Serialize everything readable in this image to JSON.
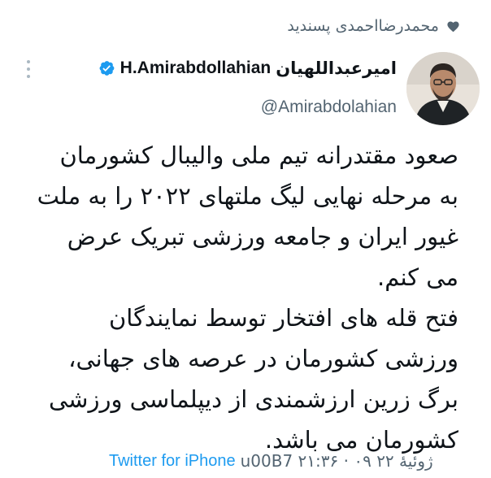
{
  "social_context": {
    "text": "محمدرضااحمدی پسندید"
  },
  "author": {
    "display_name_fa": "امیرعبداللهیان",
    "display_name_en": "H.Amirabdollahian",
    "handle": "@Amirabdolahian",
    "verified": true
  },
  "tweet": {
    "text": "صعود مقتدرانه تیم ملی والیبال کشورمان\nبه مرحله نهایی لیگ ملتهای ۲۰۲۲ را به ملت\nغیور ایران و جامعه ورزشی تبریک عرض\nمی کنم.\nفتح قله های افتخار توسط نمایندگان\nورزشی کشورمان در عرصه های جهانی،\nبرگ زرین ارزشمندی از دیپلماسی ورزشی\nکشورمان می باشد."
  },
  "footer": {
    "source": "Twitter for iPhone",
    "timestamp": "u00B7 ۲۱:۳۶ · ۰۹ ژوئیهٔ ۲۲"
  },
  "colors": {
    "accent": "#1d9bf0",
    "secondary_text": "#536471",
    "primary_text": "#0f1419"
  },
  "icons": {
    "like": "heart-icon",
    "verified": "verified-badge-icon",
    "more": "more-options-icon"
  }
}
